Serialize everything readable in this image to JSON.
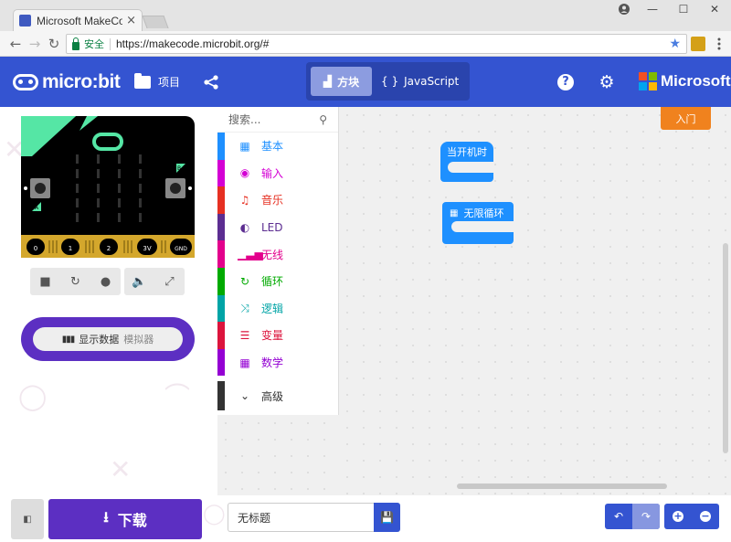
{
  "browser": {
    "tab_title": "Microsoft MakeCode fo",
    "tab_close": "×",
    "secure_label": "安全",
    "url": "https://makecode.microbit.org/#",
    "win_min": "—",
    "win_max": "☐",
    "win_close": "✕"
  },
  "header": {
    "logo": "micro:bit",
    "projects_label": "项目",
    "mode_blocks_label": "方块",
    "mode_js_label": "JavaScript",
    "help_label": "?",
    "brand": "Microsoft"
  },
  "simulator": {
    "pins": [
      "0",
      "1",
      "2",
      "3V",
      "GND"
    ],
    "button_a": "A",
    "button_b": "B",
    "data_label": "显示数据",
    "data_sub": "模拟器"
  },
  "toolbox": {
    "search_placeholder": "搜索...",
    "categories": [
      {
        "label": "基本",
        "color": "#1e90ff",
        "icon": "grid-icon"
      },
      {
        "label": "输入",
        "color": "#d400d4",
        "icon": "target-icon"
      },
      {
        "label": "音乐",
        "color": "#e63022",
        "icon": "headphones-icon"
      },
      {
        "label": "LED",
        "color": "#5c2d91",
        "icon": "toggle-icon"
      },
      {
        "label": "无线",
        "color": "#e3008c",
        "icon": "signal-icon"
      },
      {
        "label": "循环",
        "color": "#00aa00",
        "icon": "refresh-icon"
      },
      {
        "label": "逻辑",
        "color": "#00a4a6",
        "icon": "shuffle-icon"
      },
      {
        "label": "变量",
        "color": "#dc143c",
        "icon": "lines-icon"
      },
      {
        "label": "数学",
        "color": "#9400d3",
        "icon": "calculator-icon"
      }
    ],
    "advanced_label": "高级"
  },
  "workspace": {
    "intro_button": "入门",
    "on_start_label": "当开机时",
    "forever_label": "无限循环",
    "block_color": "#1e90ff"
  },
  "footer": {
    "download_label": "下载",
    "project_name": "无标题"
  },
  "colors": {
    "brand_blue": "#3454d1",
    "purple": "#5c2fc2",
    "intro_orange": "#f0821e"
  }
}
